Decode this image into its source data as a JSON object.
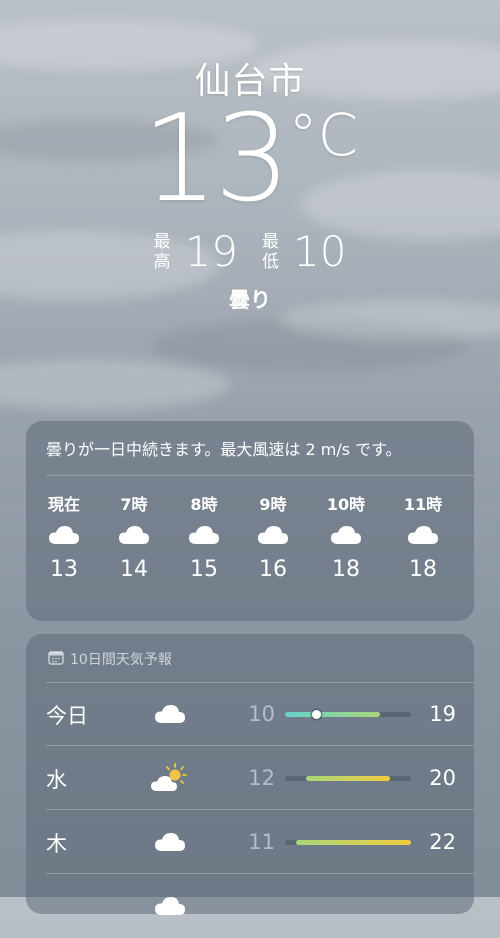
{
  "location": {
    "city": "仙台市",
    "temperature": "13",
    "unit": "°C",
    "high_label_top": "最",
    "high_label_bottom": "高",
    "high": "19",
    "low_label_top": "最",
    "low_label_bottom": "低",
    "low": "10",
    "condition": "曇り"
  },
  "hourly": {
    "summary": "曇りが一日中続きます。最大風速は 2 m/s です。",
    "items": [
      {
        "label": "現在",
        "icon": "cloud-icon",
        "temp": "13"
      },
      {
        "label": "7時",
        "icon": "cloud-icon",
        "temp": "14"
      },
      {
        "label": "8時",
        "icon": "cloud-icon",
        "temp": "15"
      },
      {
        "label": "9時",
        "icon": "cloud-icon",
        "temp": "16"
      },
      {
        "label": "10時",
        "icon": "cloud-icon",
        "temp": "18"
      },
      {
        "label": "11時",
        "icon": "cloud-icon",
        "temp": "18"
      }
    ]
  },
  "daily": {
    "title": "10日間天気予報",
    "title_icon": "calendar-icon",
    "range_min": 10,
    "range_max": 22,
    "rows": [
      {
        "day": "今日",
        "icon": "cloud-icon",
        "low": "10",
        "high": "19",
        "current_temp": 13
      },
      {
        "day": "水",
        "icon": "partly-sunny-icon",
        "low": "12",
        "high": "20"
      },
      {
        "day": "木",
        "icon": "cloud-icon",
        "low": "11",
        "high": "22"
      }
    ]
  },
  "colors": {
    "bar_cool": "#63d3c8",
    "bar_mid": "#a8d77a",
    "bar_warm": "#f2cc3f",
    "sun": "#f5c242"
  }
}
